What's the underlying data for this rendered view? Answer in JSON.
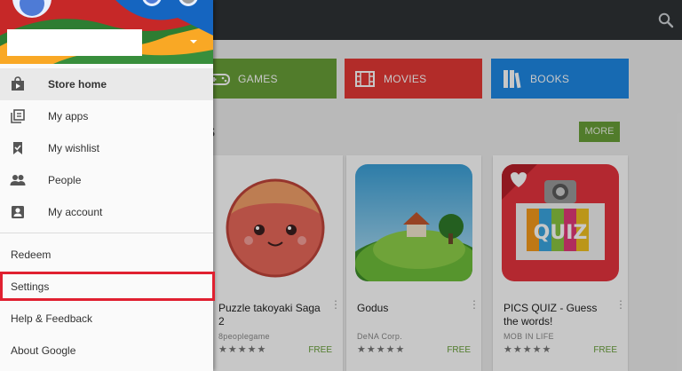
{
  "colors": {
    "games": "#689f38",
    "movies": "#e53935",
    "books": "#1e88e5",
    "topbar": "#2f3335",
    "highlight": "#e02030",
    "free": "#689f38"
  },
  "topbar": {
    "search_icon": "search-icon"
  },
  "categories": [
    {
      "label": "GAMES",
      "icon": "gamepad-icon"
    },
    {
      "label": "MOVIES",
      "icon": "film-icon"
    },
    {
      "label": "BOOKS",
      "icon": "book-icon"
    }
  ],
  "section": {
    "title_fragment": "es",
    "more_label": "MORE"
  },
  "cards": [
    {
      "title": "Puzzle takoyaki Saga 2",
      "developer": "8peoplegame",
      "stars": "★★★★★",
      "price": "FREE"
    },
    {
      "title": "Godus",
      "developer": "DeNA Corp.",
      "stars": "★★★★★",
      "price": "FREE"
    },
    {
      "title": "PICS QUIZ - Guess the words!",
      "developer": "MOB IN LIFE",
      "stars": "★★★★★",
      "price": "FREE",
      "art_text": "QUIZ"
    }
  ],
  "drawer": {
    "nav": [
      {
        "label": "Store home",
        "icon": "store-icon"
      },
      {
        "label": "My apps",
        "icon": "my-apps-icon"
      },
      {
        "label": "My wishlist",
        "icon": "wishlist-icon"
      },
      {
        "label": "People",
        "icon": "people-icon"
      },
      {
        "label": "My account",
        "icon": "account-icon"
      }
    ],
    "menu": [
      {
        "label": "Redeem"
      },
      {
        "label": "Settings",
        "highlighted": true
      },
      {
        "label": "Help & Feedback"
      },
      {
        "label": "About Google"
      }
    ]
  }
}
